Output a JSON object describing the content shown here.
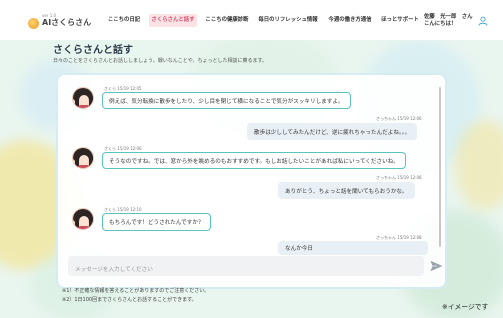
{
  "header": {
    "logo": {
      "version": "ver 1.0",
      "name": "AIさくらさん"
    },
    "nav": [
      {
        "label": "ここちの日記",
        "active": false
      },
      {
        "label": "さくらさんと話す",
        "active": true
      },
      {
        "label": "ここちの健康診断",
        "active": false
      },
      {
        "label": "毎日のリフレッシュ情報",
        "active": false
      },
      {
        "label": "今週の働き方通信",
        "active": false
      },
      {
        "label": "ほっとサポート",
        "active": false
      }
    ],
    "user": {
      "line1": "佐藤　光一郎　さん",
      "line2": "こんにちは！"
    },
    "colors": {
      "accent": "#d94f6b",
      "active_bg": "#fbe3e5"
    }
  },
  "page": {
    "title": "さくらさんと話す",
    "description": "日々のことをさくらさんとお話ししましょう。戦いなんことや、ちょっとした相談に乗るます。"
  },
  "chat": {
    "messages": [
      {
        "from": "ai",
        "meta": "さくら 15/19 12:05",
        "text": "例えば、気分転換に散歩をしたり、少し目を閉じて横になることで気分がスッキリしますよ。"
      },
      {
        "from": "user",
        "meta": "さっちゃん 15/19 12:06",
        "text": "散歩は少ししてみたんだけど、逆に疲れちゃったんだよね。。。"
      },
      {
        "from": "ai",
        "meta": "さくら 15/19 12:06",
        "text": "そうなのですね。では、窓から外を眺めるのもおすすめです。もしお話したいことがあれば私にいってくださいね。"
      },
      {
        "from": "user",
        "meta": "さっちゃん 15/19 12:08",
        "text": "ありがとう、ちょっと話を聞いてもらおうかな。"
      },
      {
        "from": "ai",
        "meta": "さくら 15/19 12:10",
        "text": "もちろんです！どうされたんですか？"
      },
      {
        "from": "user",
        "meta": "さっちゃん 15/19 12:08",
        "text": "なんか今日"
      }
    ],
    "input": {
      "placeholder": "メッセージを入力してください",
      "value": ""
    },
    "colors": {
      "ai_border": "#5cc4c0",
      "user_bubble": "#e8eff5"
    }
  },
  "notes": [
    "※1）不正確な情報を答えることがありますのでご注意ください。",
    "※2）1日100回までさくらさんとお話することができます。"
  ],
  "sample_label": "※イメージです"
}
